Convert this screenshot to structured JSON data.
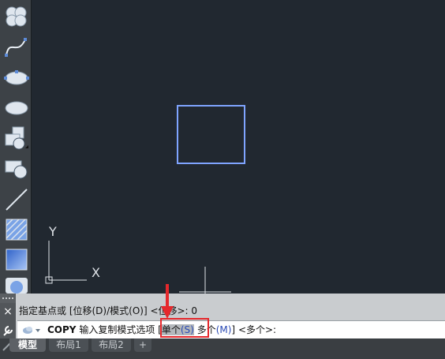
{
  "toolbar": {
    "items": [
      {
        "icon": "revision-cloud-icon"
      },
      {
        "icon": "spline-icon"
      },
      {
        "icon": "ellipse-icon"
      },
      {
        "icon": "ellipse-arc-icon"
      },
      {
        "icon": "insert-block-icon"
      },
      {
        "icon": "make-block-icon"
      },
      {
        "icon": "point-icon"
      },
      {
        "icon": "hatch-icon"
      },
      {
        "icon": "gradient-icon"
      },
      {
        "icon": "region-icon"
      }
    ]
  },
  "canvas": {
    "ucs_x_label": "X",
    "ucs_y_label": "Y",
    "rectangle_color": "#7fa4ff",
    "background_color": "#212830"
  },
  "command": {
    "history": "指定基点或 [位移(D)/模式(O)] <位移>: 0",
    "prompt_command": "COPY",
    "prompt_text": "输入复制模式选项",
    "bracket_open": "[",
    "option_single": "单个",
    "option_single_key": "(S)",
    "option_multiple": "多个",
    "option_multiple_key": "(M)",
    "bracket_close": "]",
    "default_value": "<多个>:",
    "close_icon": "×"
  },
  "tabs": [
    {
      "label": "模型",
      "active": true
    },
    {
      "label": "布局1",
      "active": false
    },
    {
      "label": "布局2",
      "active": false
    },
    {
      "label": "+",
      "active": false
    }
  ],
  "annotation_color": "#e5282c"
}
